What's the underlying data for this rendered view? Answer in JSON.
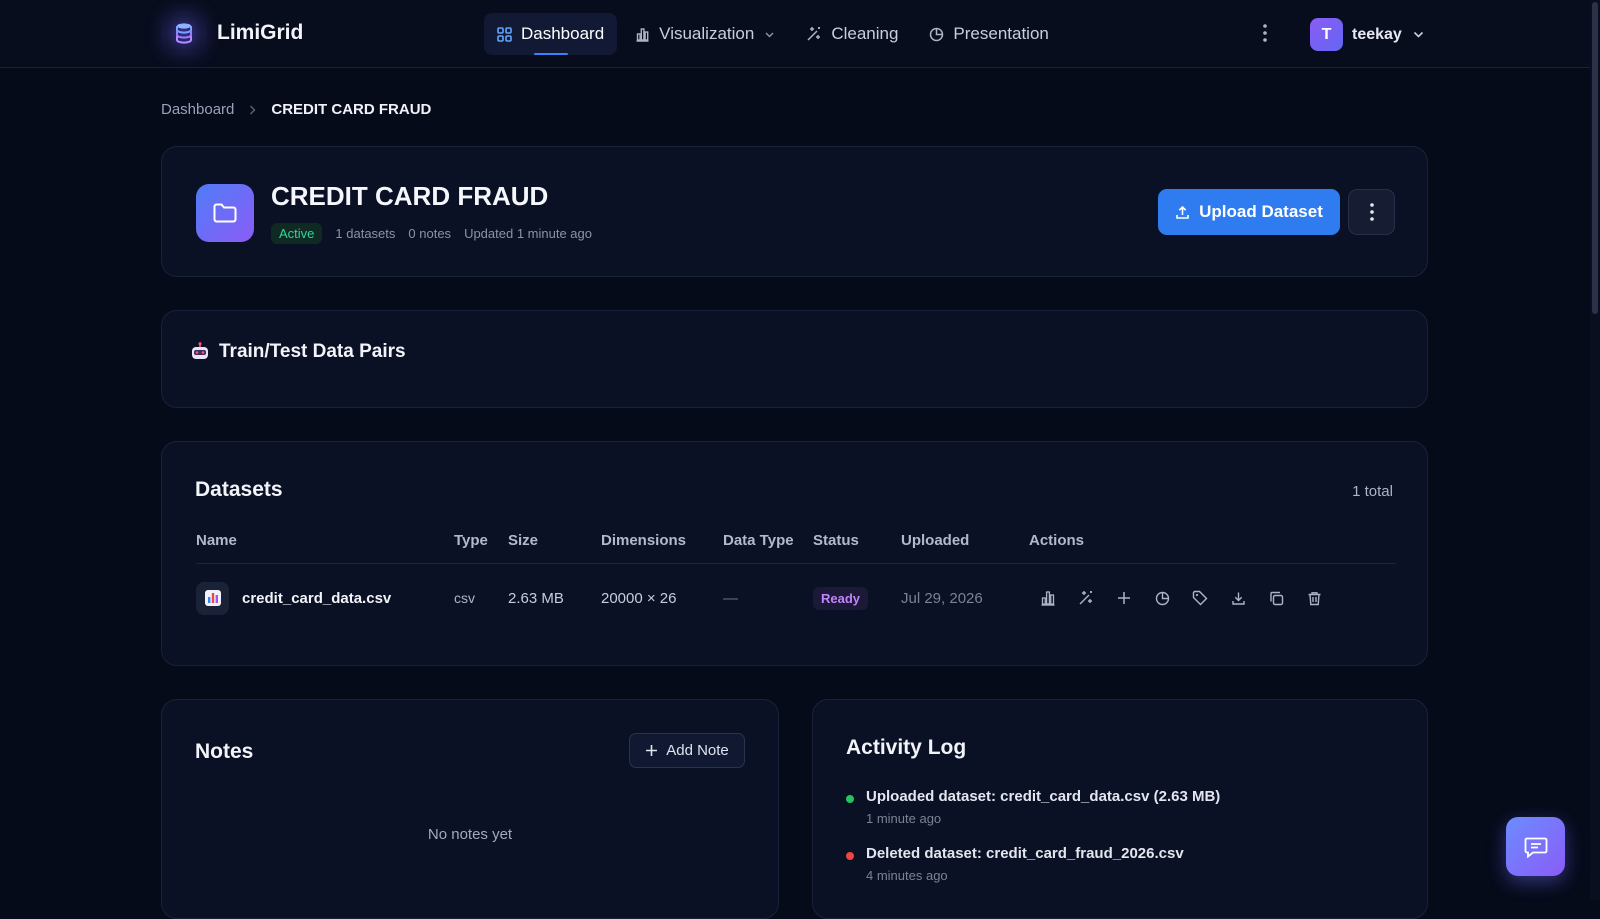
{
  "app": {
    "name": "LimiGrid"
  },
  "nav": {
    "items": [
      {
        "label": "Dashboard",
        "icon": "grid-icon",
        "active": true
      },
      {
        "label": "Visualization",
        "icon": "bar-chart-icon",
        "dropdown": true
      },
      {
        "label": "Cleaning",
        "icon": "sparkles-icon"
      },
      {
        "label": "Presentation",
        "icon": "pie-chart-icon"
      }
    ]
  },
  "user": {
    "initial": "T",
    "name": "teekay"
  },
  "breadcrumb": {
    "root": "Dashboard",
    "current": "CREDIT CARD FRAUD"
  },
  "project": {
    "title": "CREDIT CARD FRAUD",
    "status": "Active",
    "datasets": "1 datasets",
    "notes": "0 notes",
    "updated": "Updated 1 minute ago",
    "upload_label": "Upload Dataset"
  },
  "pairs": {
    "title": "Train/Test Data Pairs"
  },
  "datasets": {
    "title": "Datasets",
    "total": "1 total",
    "columns": [
      "Name",
      "Type",
      "Size",
      "Dimensions",
      "Data Type",
      "Status",
      "Uploaded",
      "Actions"
    ],
    "rows": [
      {
        "name": "credit_card_data.csv",
        "type": "csv",
        "size": "2.63 MB",
        "dimensions": "20000 × 26",
        "data_type": "—",
        "status": "Ready",
        "uploaded": "Jul 29, 2026"
      }
    ]
  },
  "notes": {
    "title": "Notes",
    "add_label": "Add Note",
    "empty": "No notes yet"
  },
  "activity": {
    "title": "Activity Log",
    "items": [
      {
        "text": "Uploaded dataset: credit_card_data.csv (2.63 MB)",
        "time": "1 minute ago",
        "color": "#22c55e"
      },
      {
        "text": "Deleted dataset: credit_card_fraud_2026.csv",
        "time": "4 minutes ago",
        "color": "#ef4444"
      }
    ]
  },
  "colors": {
    "accent": "#2f7cf0",
    "active": "#34d399",
    "ready": "#c084fc"
  }
}
